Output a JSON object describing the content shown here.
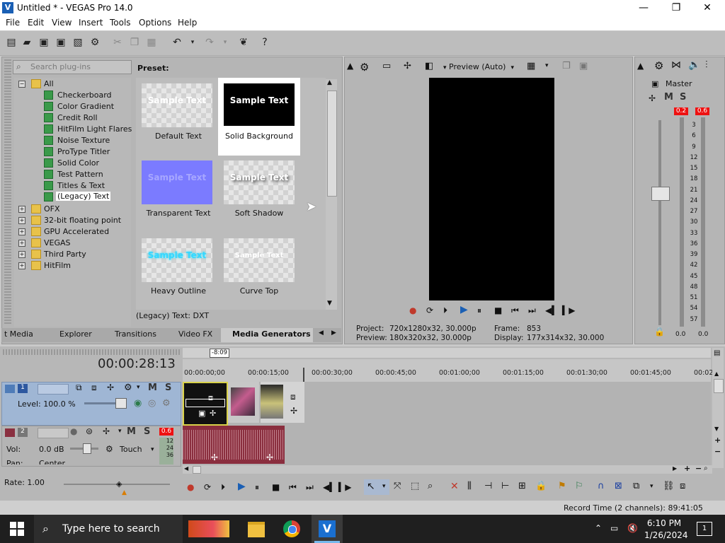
{
  "window": {
    "title": "Untitled * - VEGAS Pro 14.0",
    "logo": "V",
    "controls": {
      "minimize": "—",
      "maximize": "❐",
      "close": "✕"
    }
  },
  "menu": [
    "File",
    "Edit",
    "View",
    "Insert",
    "Tools",
    "Options",
    "Help"
  ],
  "plugins": {
    "search_placeholder": "Search plug-ins",
    "tree_all": "All",
    "tree_children": [
      "Checkerboard",
      "Color Gradient",
      "Credit Roll",
      "HitFilm Light Flares",
      "Noise Texture",
      "ProType Titler",
      "Solid Color",
      "Test Pattern",
      "Titles & Text",
      "(Legacy) Text"
    ],
    "tree_folders": [
      "OFX",
      "32-bit floating point",
      "GPU Accelerated",
      "VEGAS",
      "Third Party",
      "HitFilm"
    ],
    "preset_label": "Preset:",
    "presets": [
      {
        "name": "Default Text",
        "thumb_text": "Sample Text"
      },
      {
        "name": "Solid Background",
        "thumb_text": "Sample Text"
      },
      {
        "name": "Transparent Text",
        "thumb_text": "Sample Text"
      },
      {
        "name": "Soft Shadow",
        "thumb_text": "Sample Text"
      },
      {
        "name": "Heavy Outline",
        "thumb_text": "Sample Text"
      },
      {
        "name": "Curve Top",
        "thumb_text": "Sample Text"
      }
    ],
    "selected_plugin": "(Legacy) Text: DXT",
    "tabs": [
      "t Media",
      "Explorer",
      "Transitions",
      "Video FX",
      "Media Generators"
    ]
  },
  "preview": {
    "mode": "Preview (Auto)",
    "project_label": "Project:",
    "project_value": "720x1280x32, 30.000p",
    "preview_label": "Preview:",
    "preview_value": "180x320x32, 30.000p",
    "frame_label": "Frame:",
    "frame_value": "853",
    "display_label": "Display:",
    "display_value": "177x314x32, 30.000"
  },
  "mixer": {
    "title": "Master",
    "peak_left": "0.2",
    "peak_right": "0.6",
    "scale": [
      "3",
      "6",
      "9",
      "12",
      "15",
      "18",
      "21",
      "24",
      "27",
      "30",
      "33",
      "36",
      "39",
      "42",
      "45",
      "48",
      "51",
      "54",
      "57"
    ],
    "bottom_left": "0.0",
    "bottom_right": "0.0",
    "m_label": "M",
    "s_label": "S"
  },
  "timeline": {
    "timecode": "00:00:28:13",
    "ruler_marker": "-8:09",
    "ruler_labels": [
      "00:00:00;00",
      "00:00:15;00",
      "00:00:30;00",
      "00:00:45;00",
      "00:01:00;00",
      "00:01:15;00",
      "00:01:30;00",
      "00:01:45;00",
      "00:02"
    ],
    "track1_num": "1",
    "track1_level": "Level: 100.0 %",
    "track2_num": "2",
    "track2_vol": "Vol:",
    "track2_vol_value": "0.0 dB",
    "track2_touch": "Touch",
    "track2_pan": "Pan:",
    "track2_pan_value": "Center",
    "track2_peak": "0.6",
    "track2_scale": [
      "12",
      "24",
      "36"
    ],
    "m_label": "M",
    "s_label": "S",
    "rate": "Rate: 1.00"
  },
  "status": {
    "record_time": "Record Time (2 channels): 89:41:05"
  },
  "taskbar": {
    "search_placeholder": "Type here to search",
    "time": "6:10 PM",
    "date": "1/26/2024",
    "notification_count": "1"
  }
}
